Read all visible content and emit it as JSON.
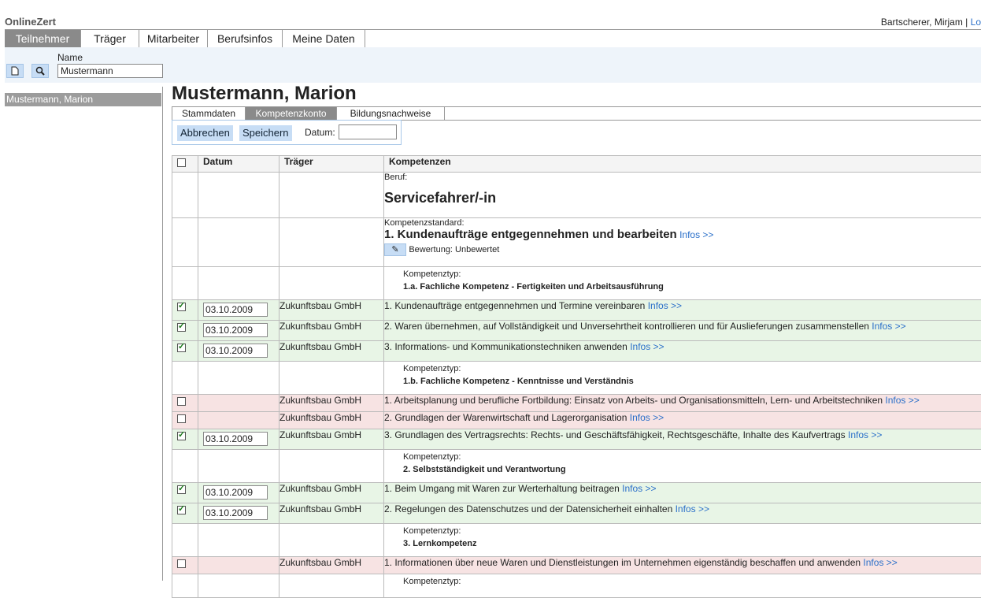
{
  "app": {
    "title": "OnlineZert"
  },
  "user": {
    "name": "Bartscherer, Mirjam |",
    "logout": "Lo"
  },
  "nav": {
    "tabs": [
      "Teilnehmer",
      "Träger",
      "Mitarbeiter",
      "Berufsinfos",
      "Meine Daten"
    ]
  },
  "search": {
    "name_label": "Name",
    "name_value": "Mustermann"
  },
  "results": [
    "Mustermann, Marion"
  ],
  "person": {
    "name": "Mustermann, Marion"
  },
  "subtabs": [
    "Stammdaten",
    "Kompetenzkonto",
    "Bildungsnachweise"
  ],
  "actions": {
    "cancel": "Abbrechen",
    "save": "Speichern",
    "date_label": "Datum:",
    "date_value": ""
  },
  "table": {
    "headers": [
      "Datum",
      "Träger",
      "Kompetenzen"
    ],
    "beruf_label": "Beruf:",
    "beruf": "Servicefahrer/-in",
    "standard_label": "Kompetenzstandard:",
    "standard": "1. Kundenaufträge entgegennehmen und bearbeiten",
    "info": "Infos >>",
    "rating": "Bewertung: Unbewertet",
    "typ_label": "Kompetenztyp:",
    "groups": [
      {
        "title": "1.a. Fachliche Kompetenz - Fertigkeiten und Arbeitsausführung",
        "rows": [
          {
            "checked": true,
            "date": "03.10.2009",
            "traeger": "Zukunftsbau GmbH",
            "text": "1. Kundenaufträge entgegennehmen und Termine vereinbaren"
          },
          {
            "checked": true,
            "date": "03.10.2009",
            "traeger": "Zukunftsbau GmbH",
            "text": "2. Waren übernehmen, auf Vollständigkeit und Unversehrtheit kontrollieren und für Auslieferungen zusammenstellen"
          },
          {
            "checked": true,
            "date": "03.10.2009",
            "traeger": "Zukunftsbau GmbH",
            "text": "3. Informations- und Kommunikationstechniken anwenden"
          }
        ]
      },
      {
        "title": "1.b. Fachliche Kompetenz - Kenntnisse und Verständnis",
        "rows": [
          {
            "checked": false,
            "date": "",
            "traeger": "Zukunftsbau GmbH",
            "text": "1. Arbeitsplanung und berufliche Fortbildung: Einsatz von Arbeits- und Organisationsmitteln, Lern- und Arbeitstechniken"
          },
          {
            "checked": false,
            "date": "",
            "traeger": "Zukunftsbau GmbH",
            "text": "2. Grundlagen der Warenwirtschaft und Lagerorganisation"
          },
          {
            "checked": true,
            "date": "03.10.2009",
            "traeger": "Zukunftsbau GmbH",
            "text": "3. Grundlagen des Vertragsrechts: Rechts- und Geschäftsfähigkeit, Rechtsgeschäfte, Inhalte des Kaufvertrags"
          }
        ]
      },
      {
        "title": "2. Selbstständigkeit und Verantwortung",
        "rows": [
          {
            "checked": true,
            "date": "03.10.2009",
            "traeger": "Zukunftsbau GmbH",
            "text": "1. Beim Umgang mit Waren zur Werterhaltung beitragen"
          },
          {
            "checked": true,
            "date": "03.10.2009",
            "traeger": "Zukunftsbau GmbH",
            "text": "2. Regelungen des Datenschutzes und der Datensicherheit einhalten"
          }
        ]
      },
      {
        "title": "3. Lernkompetenz",
        "rows": [
          {
            "checked": false,
            "date": "",
            "traeger": "Zukunftsbau GmbH",
            "text": "1. Informationen über neue Waren und Dienstleistungen im Unternehmen eigenständig beschaffen und anwenden"
          }
        ]
      }
    ],
    "trailing_typ_label": "Kompetenztyp:"
  }
}
